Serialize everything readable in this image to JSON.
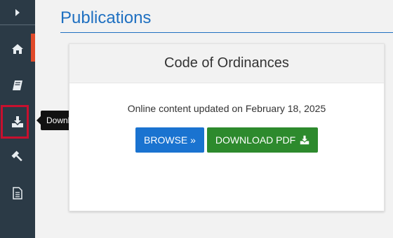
{
  "sidebar": {
    "items": [
      {
        "icon": "home-icon"
      },
      {
        "icon": "book-icon"
      },
      {
        "icon": "download-icon"
      },
      {
        "icon": "gavel-icon"
      },
      {
        "icon": "document-icon"
      }
    ]
  },
  "tooltip": {
    "text": "Download publication PDFs"
  },
  "page": {
    "title": "Publications"
  },
  "card": {
    "title": "Code of Ordinances",
    "subtitle": "Online content updated on February 18, 2025",
    "browse_label": "BROWSE »",
    "download_label": "DOWNLOAD PDF"
  },
  "colors": {
    "sidebar": "#2b3a46",
    "accent_title": "#1f70c1",
    "browse_button": "#1a73d0",
    "download_button": "#2d8a2d",
    "highlight": "#c8102e"
  }
}
